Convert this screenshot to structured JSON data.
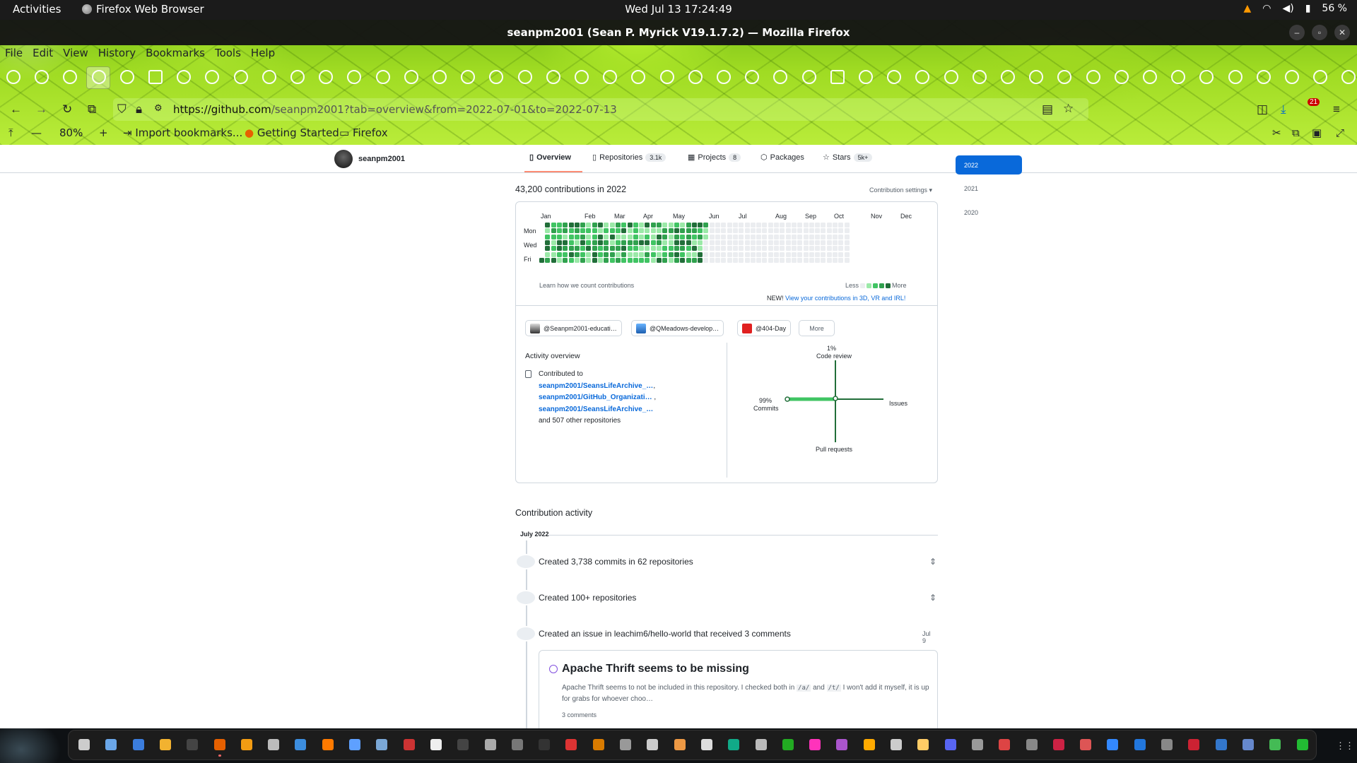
{
  "system": {
    "activities": "Activities",
    "app_name": "Firefox Web Browser",
    "clock": "Wed Jul 13  17:24:49",
    "battery": "56 %"
  },
  "window": {
    "title": "seanpm2001 (Sean P. Myrick V19.1.7.2) — Mozilla Firefox"
  },
  "menu": [
    "File",
    "Edit",
    "View",
    "History",
    "Bookmarks",
    "Tools",
    "Help"
  ],
  "urlbar": {
    "domain": "https://github.com",
    "path": "/seanpm2001?tab=overview&from=2022-07-01&to=2022-07-13",
    "download_badge": "21"
  },
  "bookmarks": {
    "zoom": "80%",
    "items": [
      "Import bookmarks...",
      "Getting Started",
      "Firefox"
    ]
  },
  "gh": {
    "username": "seanpm2001",
    "tabs": [
      {
        "label": "Overview",
        "count": ""
      },
      {
        "label": "Repositories",
        "count": "3.1k"
      },
      {
        "label": "Projects",
        "count": "8"
      },
      {
        "label": "Packages",
        "count": ""
      },
      {
        "label": "Stars",
        "count": "5k+"
      }
    ],
    "contributions_title": "43,200 contributions in 2022",
    "contribution_settings": "Contribution settings ▾",
    "months": [
      "Jan",
      "Feb",
      "Mar",
      "Apr",
      "May",
      "Jun",
      "Jul",
      "Aug",
      "Sep",
      "Oct",
      "Nov",
      "Dec"
    ],
    "days": [
      "Mon",
      "Wed",
      "Fri"
    ],
    "learn": "Learn how we count contributions",
    "legend_less": "Less",
    "legend_more": "More",
    "new_prefix": "NEW!",
    "new_link": "View your contributions in 3D, VR and IRL!",
    "orgs": [
      "@Seanpm2001-educati…",
      "@QMeadows-develop…",
      "@404-Day",
      "More"
    ],
    "activity_overview": "Activity overview",
    "contributed_to": "Contributed to",
    "repos": [
      "seanpm2001/SeansLifeArchive_…",
      "seanpm2001/GitHub_Organizati…",
      "seanpm2001/SeansLifeArchive_…"
    ],
    "other_repos": "and 507 other repositories",
    "radar": {
      "code_review_pct": "1%",
      "code_review": "Code review",
      "commits_pct": "99%",
      "commits": "Commits",
      "issues": "Issues",
      "pull_requests": "Pull requests"
    },
    "years": [
      "2022",
      "2021",
      "2020"
    ],
    "activity_title": "Contribution activity",
    "month_head": "July 2022",
    "events": [
      {
        "text": "Created 3,738 commits in 62 repositories",
        "date": ""
      },
      {
        "text": "Created 100+ repositories",
        "date": ""
      },
      {
        "text": "Created an issue in leachim6/hello-world that received 3 comments",
        "date": "Jul 9"
      }
    ],
    "issue": {
      "title": "Apache Thrift seems to be missing",
      "body_a": "Apache Thrift seems to not be included in this repository. I checked both in",
      "code1": "/a/",
      "and": "and",
      "code2": "/t/",
      "body_b": "I won't add it myself, it is up for grabs for whoever choo…",
      "comments": "3 comments"
    }
  }
}
